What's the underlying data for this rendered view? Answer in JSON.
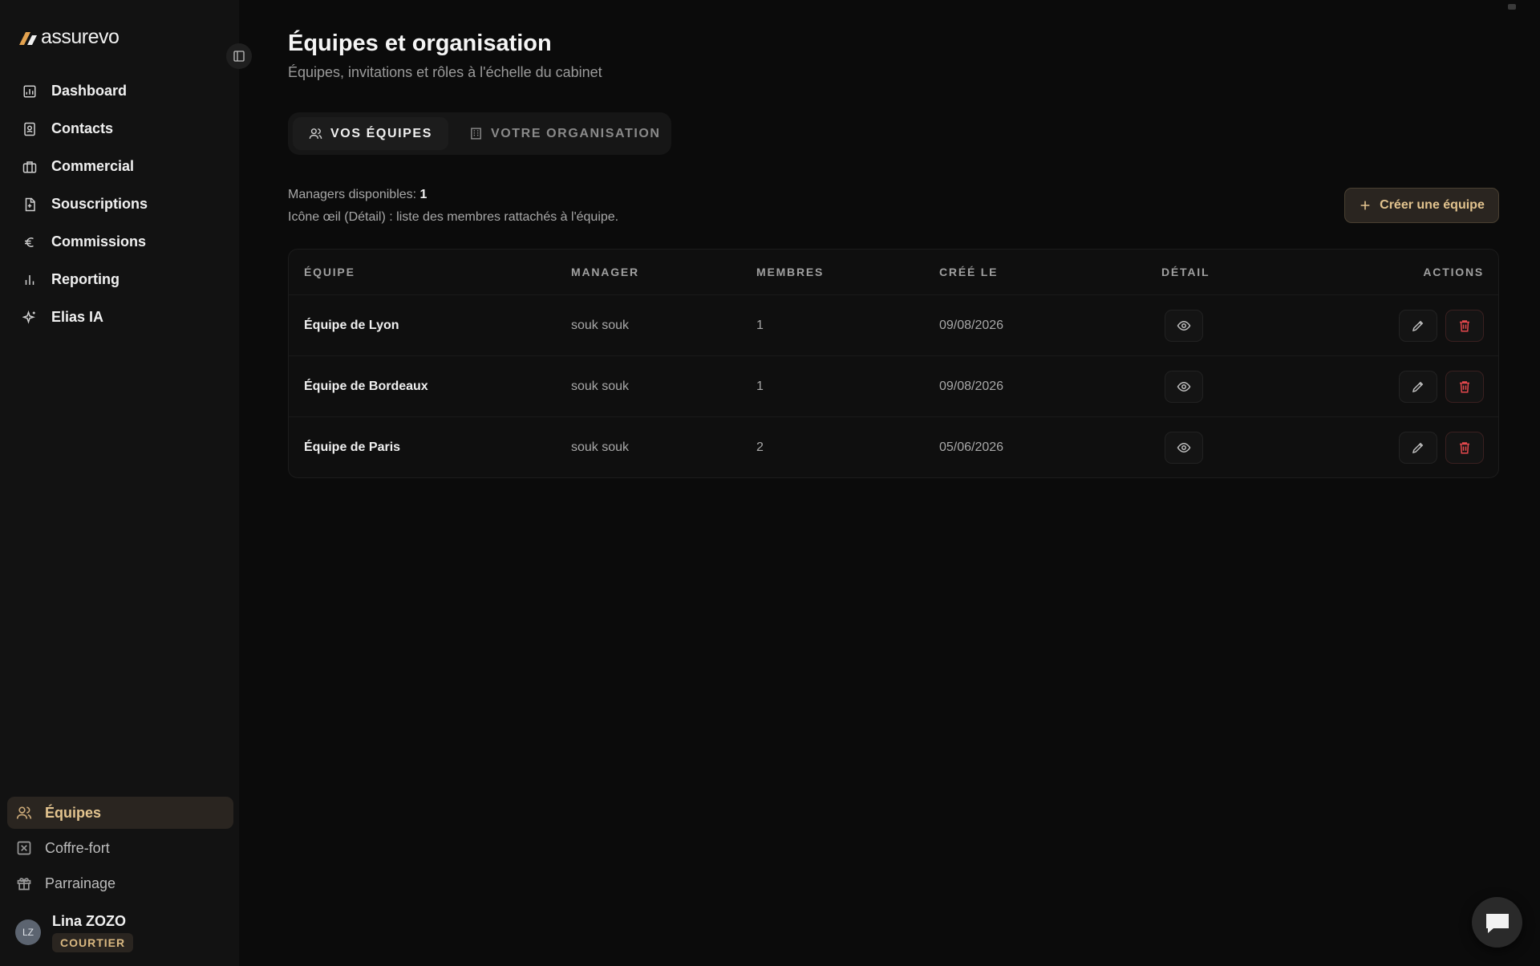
{
  "app": {
    "logo_text": "assurevo",
    "brand_color": "#e3a24f",
    "accent_color": "#e3c48f"
  },
  "sidebar": {
    "items": [
      {
        "label": "Dashboard",
        "icon": "dashboard-icon"
      },
      {
        "label": "Contacts",
        "icon": "contacts-icon"
      },
      {
        "label": "Commercial",
        "icon": "briefcase-icon"
      },
      {
        "label": "Souscriptions",
        "icon": "document-plus-icon"
      },
      {
        "label": "Commissions",
        "icon": "euro-icon"
      },
      {
        "label": "Reporting",
        "icon": "bar-chart-icon"
      },
      {
        "label": "Elias IA",
        "icon": "sparkles-icon"
      }
    ],
    "bottom_items": [
      {
        "label": "Équipes",
        "icon": "users-icon",
        "active": true
      },
      {
        "label": "Coffre-fort",
        "icon": "vault-icon",
        "active": false
      },
      {
        "label": "Parrainage",
        "icon": "gift-icon",
        "active": false
      }
    ],
    "user": {
      "initials": "LZ",
      "name": "Lina ZOZO",
      "role": "COURTIER"
    }
  },
  "main": {
    "title": "Équipes et organisation",
    "subtitle": "Équipes, invitations et rôles à l'échelle du cabinet",
    "tabs": [
      {
        "label": "VOS ÉQUIPES",
        "icon": "users-icon",
        "active": true
      },
      {
        "label": "VOTRE ORGANISATION",
        "icon": "building-icon",
        "active": false
      }
    ],
    "managers_label": "Managers disponibles:",
    "managers_count": "1",
    "hint": "Icône œil (Détail) : liste des membres rattachés à l'équipe.",
    "create_button": "Créer une équipe",
    "table": {
      "columns": [
        "ÉQUIPE",
        "MANAGER",
        "MEMBRES",
        "CRÉÉ LE",
        "DÉTAIL",
        "ACTIONS"
      ],
      "rows": [
        {
          "team": "Équipe de Lyon",
          "manager": "souk souk",
          "members": "1",
          "created": "09/08/2026"
        },
        {
          "team": "Équipe de Bordeaux",
          "manager": "souk souk",
          "members": "1",
          "created": "09/08/2026"
        },
        {
          "team": "Équipe de Paris",
          "manager": "souk souk",
          "members": "2",
          "created": "05/06/2026"
        }
      ]
    }
  }
}
